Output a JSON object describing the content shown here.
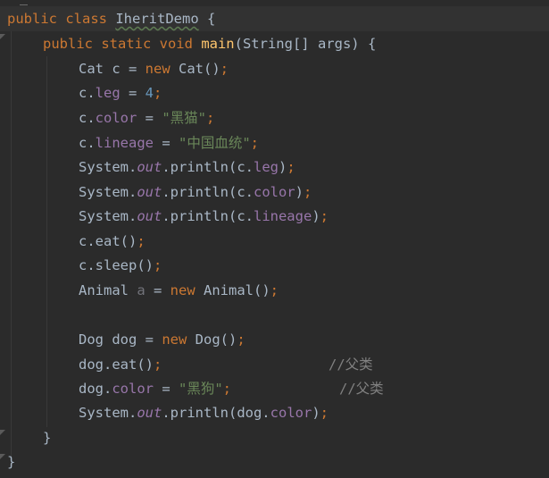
{
  "code": {
    "line1": {
      "kw": "public class ",
      "name": "IheritDemo",
      "rest": " {"
    },
    "line2": {
      "kw": "public static void ",
      "fn": "main",
      "rest": "(String[] args) {"
    },
    "line3": {
      "a": "Cat c = ",
      "kw": "new",
      "b": " Cat()",
      "semi": ";"
    },
    "line4": {
      "a": "c.",
      "fld": "leg",
      "b": " = ",
      "num": "4",
      "semi": ";"
    },
    "line5": {
      "a": "c.",
      "fld": "color",
      "b": " = ",
      "str": "\"黑猫\"",
      "semi": ";"
    },
    "line6": {
      "a": "c.",
      "fld": "lineage",
      "b": " = ",
      "str": "\"中国血统\"",
      "semi": ";"
    },
    "line7": {
      "a": "System.",
      "out": "out",
      "b": ".println(c.",
      "fld": "leg",
      "c": ")",
      "semi": ";"
    },
    "line8": {
      "a": "System.",
      "out": "out",
      "b": ".println(c.",
      "fld": "color",
      "c": ")",
      "semi": ";"
    },
    "line9": {
      "a": "System.",
      "out": "out",
      "b": ".println(c.",
      "fld": "lineage",
      "c": ")",
      "semi": ";"
    },
    "line10": {
      "a": "c.eat()",
      "semi": ";"
    },
    "line11": {
      "a": "c.sleep()",
      "semi": ";"
    },
    "line12": {
      "a": "Animal ",
      "var": "a",
      "b": " = ",
      "kw": "new",
      "c": " Animal()",
      "semi": ";"
    },
    "line14": {
      "a": "Dog dog = ",
      "kw": "new",
      "b": " Dog()",
      "semi": ";"
    },
    "line15": {
      "a": "dog.eat()",
      "semi": ";",
      "cmt": "//父类"
    },
    "line16": {
      "a": "dog.",
      "fld": "color",
      "b": " = ",
      "str": "\"黑狗\"",
      "semi": ";",
      "cmt": "//父类"
    },
    "line17": {
      "a": "System.",
      "out": "out",
      "b": ".println(dog.",
      "fld": "color",
      "c": ")",
      "semi": ";"
    },
    "line18": {
      "a": "}"
    },
    "line19": {
      "a": "}"
    }
  },
  "colors": {
    "background": "#2b2b2b",
    "keyword": "#cc7832",
    "method": "#ffc66d",
    "field": "#9876aa",
    "string": "#6a8759",
    "number": "#6897bb",
    "comment": "#808080",
    "text": "#a9b7c6"
  }
}
